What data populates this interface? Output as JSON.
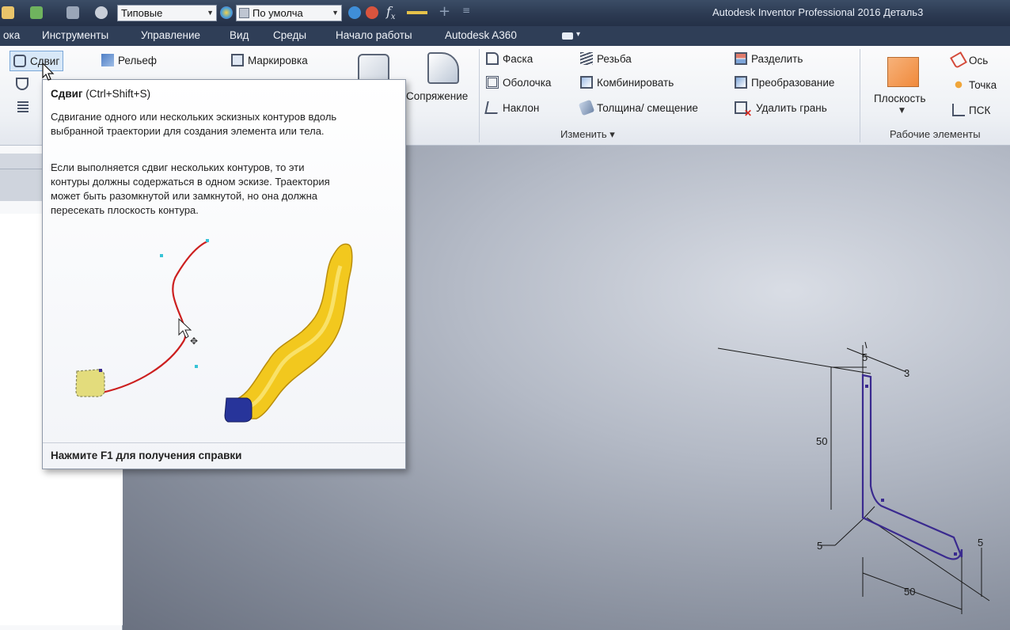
{
  "titlebar": {
    "style_combo": "Типовые",
    "appearance_combo": "По умолча",
    "window_title": "Autodesk Inventor Professional 2016   Деталь3"
  },
  "tabs": [
    "ока",
    "Инструменты",
    "Управление",
    "Вид",
    "Среды",
    "Начало работы",
    "Autodesk A360"
  ],
  "ribbon": {
    "create": {
      "sweep": "Сдвиг",
      "emboss": "Рельеф",
      "decal": "Маркировка",
      "fillet": "Сопряжение"
    },
    "modify": {
      "chamfer": "Фаска",
      "thread": "Резьба",
      "split": "Разделить",
      "shell": "Оболочка",
      "combine": "Комбинировать",
      "direct_edit": "Преобразование",
      "draft": "Наклон",
      "thicken": "Толщина/ смещение",
      "delete_face": "Удалить грань",
      "panel_label": "Изменить ▾"
    },
    "work_features": {
      "plane": "Плоскость",
      "axis": "Ось",
      "point": "Точка",
      "ucs": "ПСК",
      "panel_label": "Рабочие элементы"
    }
  },
  "tooltip": {
    "title": "Сдвиг",
    "shortcut": " (Ctrl+Shift+S)",
    "para1_line1": "Сдвигание одного или нескольких эскизных контуров вдоль",
    "para1_line2": "выбранной траектории для создания элемента или тела.",
    "para2_line1": "Если выполняется сдвиг нескольких контуров, то эти",
    "para2_line2": "контуры должны содержаться в одном эскизе. Траектория",
    "para2_line3": "может быть разомкнутой или замкнутой, но она должна",
    "para2_line4": "пересекать плоскость контура.",
    "footer": "Нажмите F1 для получения справки"
  },
  "sketch_dimensions": {
    "top_width": "5",
    "top_offset": "3",
    "vertical_length": "50",
    "corner_thickness": "5",
    "right_thickness": "5",
    "horizontal_length": "50"
  },
  "colors": {
    "accent": "#2f3e57",
    "sketch": "#3a2a8f",
    "path": "#cc1f1f",
    "sweep_body": "#f2c81e"
  }
}
